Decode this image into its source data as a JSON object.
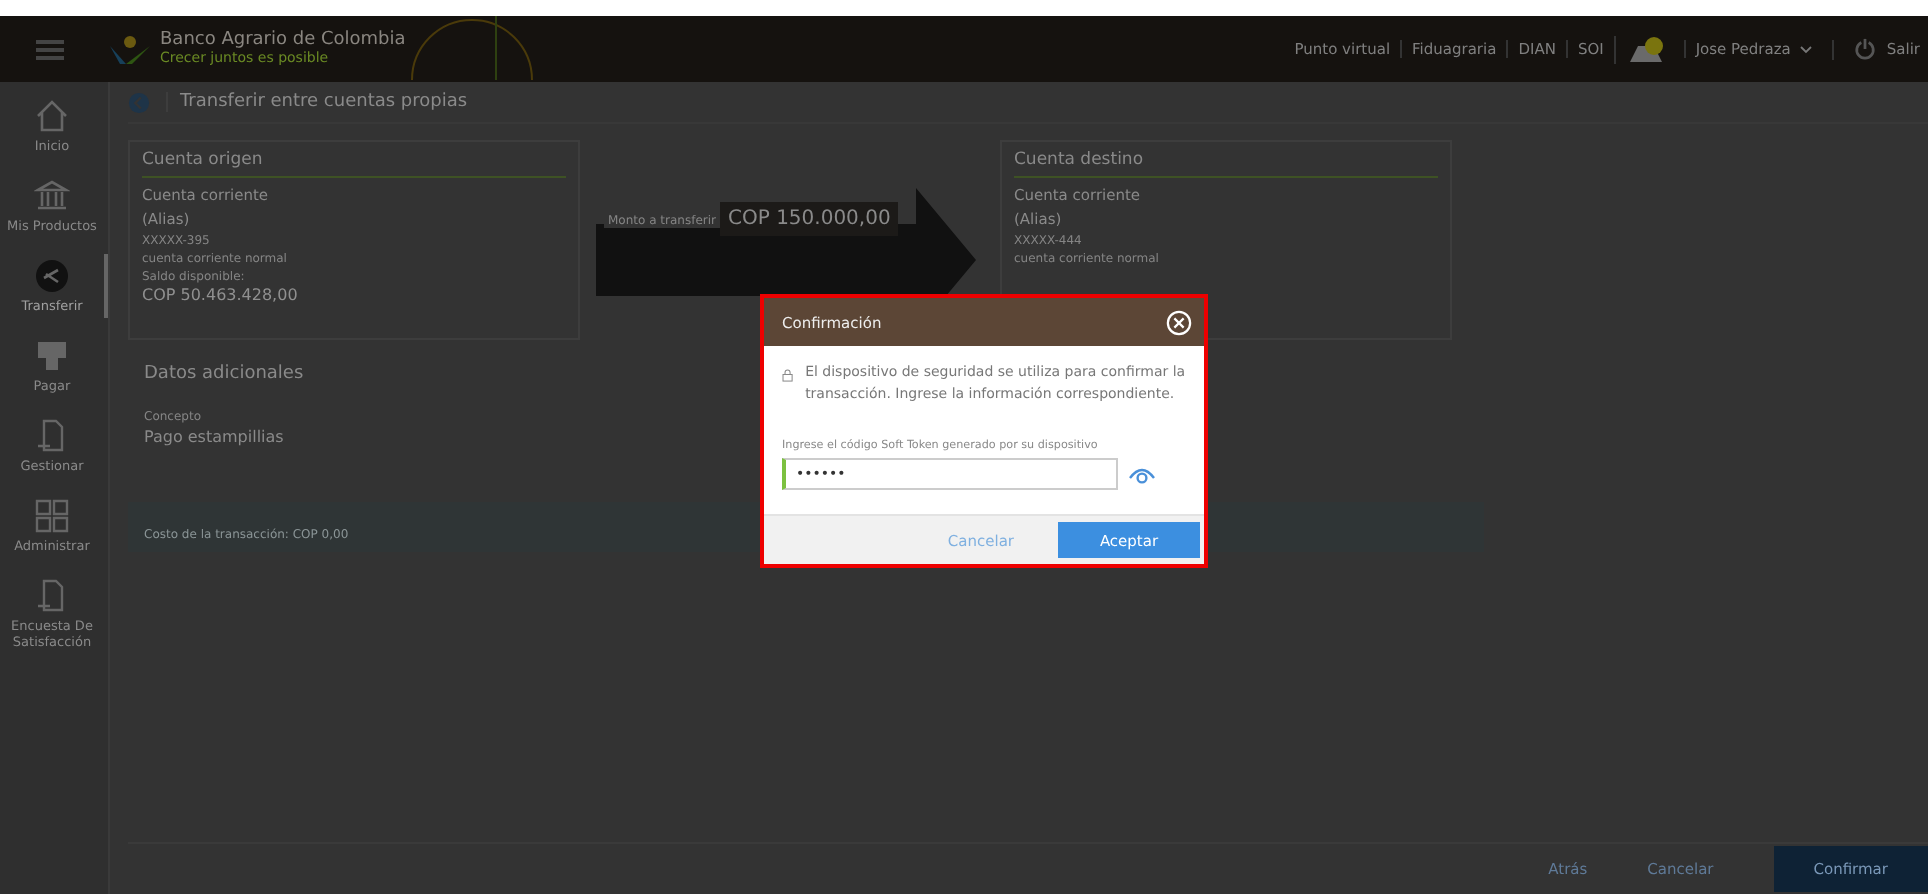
{
  "header": {
    "bank_name": "Banco Agrario de Colombia",
    "slogan": "Crecer juntos es posible",
    "links": [
      "Punto virtual",
      "Fiduagraria",
      "DIAN",
      "SOI"
    ],
    "user": "Jose Pedraza",
    "logout": "Salir"
  },
  "sidebar": {
    "items": [
      {
        "label": "Inicio",
        "selected": false
      },
      {
        "label": "Mis Productos",
        "selected": false
      },
      {
        "label": "Transferir",
        "selected": true
      },
      {
        "label": "Pagar",
        "selected": false
      },
      {
        "label": "Gestionar",
        "selected": false
      },
      {
        "label": "Administrar",
        "selected": false
      },
      {
        "label": "Encuesta De Satisfacción",
        "selected": false
      }
    ]
  },
  "page": {
    "title": "Transferir entre cuentas propias",
    "origin": {
      "title": "Cuenta origen",
      "type": "Cuenta corriente",
      "alias": "(Alias)",
      "number": "XXXXX-395",
      "description": "cuenta corriente normal",
      "balance_label": "Saldo disponible:",
      "balance": "COP 50.463.428,00"
    },
    "amount": {
      "label": "Monto a transferir",
      "value": "COP 150.000,00"
    },
    "destination": {
      "title": "Cuenta destino",
      "type": "Cuenta corriente",
      "alias": "(Alias)",
      "number": "XXXXX-444",
      "description": "cuenta corriente normal"
    },
    "additional": {
      "title": "Datos adicionales",
      "concept_label": "Concepto",
      "concept": "Pago estampillias"
    },
    "cost": "Costo de la transacción: COP 0,00",
    "buttons": [
      "Atrás",
      "Cancelar",
      "Confirmar"
    ]
  },
  "dialog": {
    "title": "Confirmación",
    "message": "El dispositivo de seguridad se utiliza para confirmar la transacción. Ingrese la información correspondiente.",
    "field_label": "Ingrese el código Soft Token generado por su dispositivo",
    "field_value": "••••••",
    "cancel": "Cancelar",
    "accept": "Aceptar"
  }
}
